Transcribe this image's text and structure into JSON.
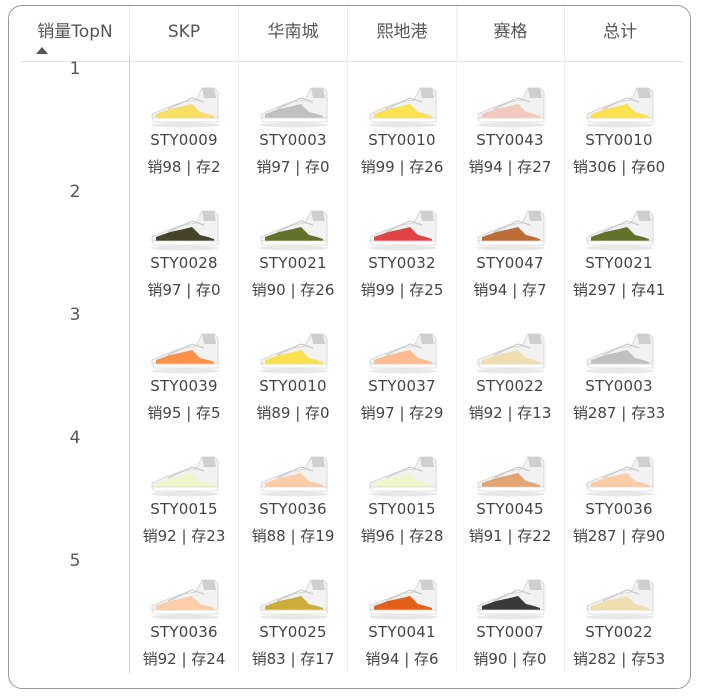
{
  "header": {
    "first_col": "销量TopN",
    "columns": [
      "SKP",
      "华南城",
      "熙地港",
      "赛格",
      "总计"
    ]
  },
  "rows": [
    {
      "rank": "1",
      "cells": [
        {
          "sku": "STY0009",
          "text": "销98 | 存2",
          "color": "#f9dc5c"
        },
        {
          "sku": "STY0003",
          "text": "销97 | 存0",
          "color": "#bdbdbd"
        },
        {
          "sku": "STY0010",
          "text": "销99 | 存26",
          "color": "#fde047"
        },
        {
          "sku": "STY0043",
          "text": "销94 | 存27",
          "color": "#f1c6b8"
        },
        {
          "sku": "STY0010",
          "text": "销306 | 存60",
          "color": "#fde047"
        }
      ]
    },
    {
      "rank": "2",
      "cells": [
        {
          "sku": "STY0028",
          "text": "销97 | 存0",
          "color": "#3b3a1e"
        },
        {
          "sku": "STY0021",
          "text": "销90 | 存26",
          "color": "#5a6b1e"
        },
        {
          "sku": "STY0032",
          "text": "销99 | 存25",
          "color": "#e03a3a"
        },
        {
          "sku": "STY0047",
          "text": "销94 | 存7",
          "color": "#b9652c"
        },
        {
          "sku": "STY0021",
          "text": "销297 | 存41",
          "color": "#5a6b1e"
        }
      ]
    },
    {
      "rank": "3",
      "cells": [
        {
          "sku": "STY0039",
          "text": "销95 | 存5",
          "color": "#ff8a3d"
        },
        {
          "sku": "STY0010",
          "text": "销89 | 存0",
          "color": "#fde047"
        },
        {
          "sku": "STY0037",
          "text": "销97 | 存29",
          "color": "#ffb88a"
        },
        {
          "sku": "STY0022",
          "text": "销92 | 存13",
          "color": "#f0dcaa"
        },
        {
          "sku": "STY0003",
          "text": "销287 | 存33",
          "color": "#bdbdbd"
        }
      ]
    },
    {
      "rank": "4",
      "cells": [
        {
          "sku": "STY0015",
          "text": "销92 | 存23",
          "color": "#eef5c8"
        },
        {
          "sku": "STY0036",
          "text": "销88 | 存19",
          "color": "#ffc9a3"
        },
        {
          "sku": "STY0015",
          "text": "销96 | 存28",
          "color": "#eef5c8"
        },
        {
          "sku": "STY0045",
          "text": "销91 | 存22",
          "color": "#e09f6a"
        },
        {
          "sku": "STY0036",
          "text": "销287 | 存90",
          "color": "#ffc9a3"
        }
      ]
    },
    {
      "rank": "5",
      "cells": [
        {
          "sku": "STY0036",
          "text": "销92 | 存24",
          "color": "#ffc9a3"
        },
        {
          "sku": "STY0025",
          "text": "销83 | 存17",
          "color": "#c9a92e"
        },
        {
          "sku": "STY0041",
          "text": "销94 | 存6",
          "color": "#e2570f"
        },
        {
          "sku": "STY0007",
          "text": "销90 | 存0",
          "color": "#2e2e2e"
        },
        {
          "sku": "STY0022",
          "text": "销282 | 存53",
          "color": "#f0dcaa"
        }
      ]
    }
  ]
}
